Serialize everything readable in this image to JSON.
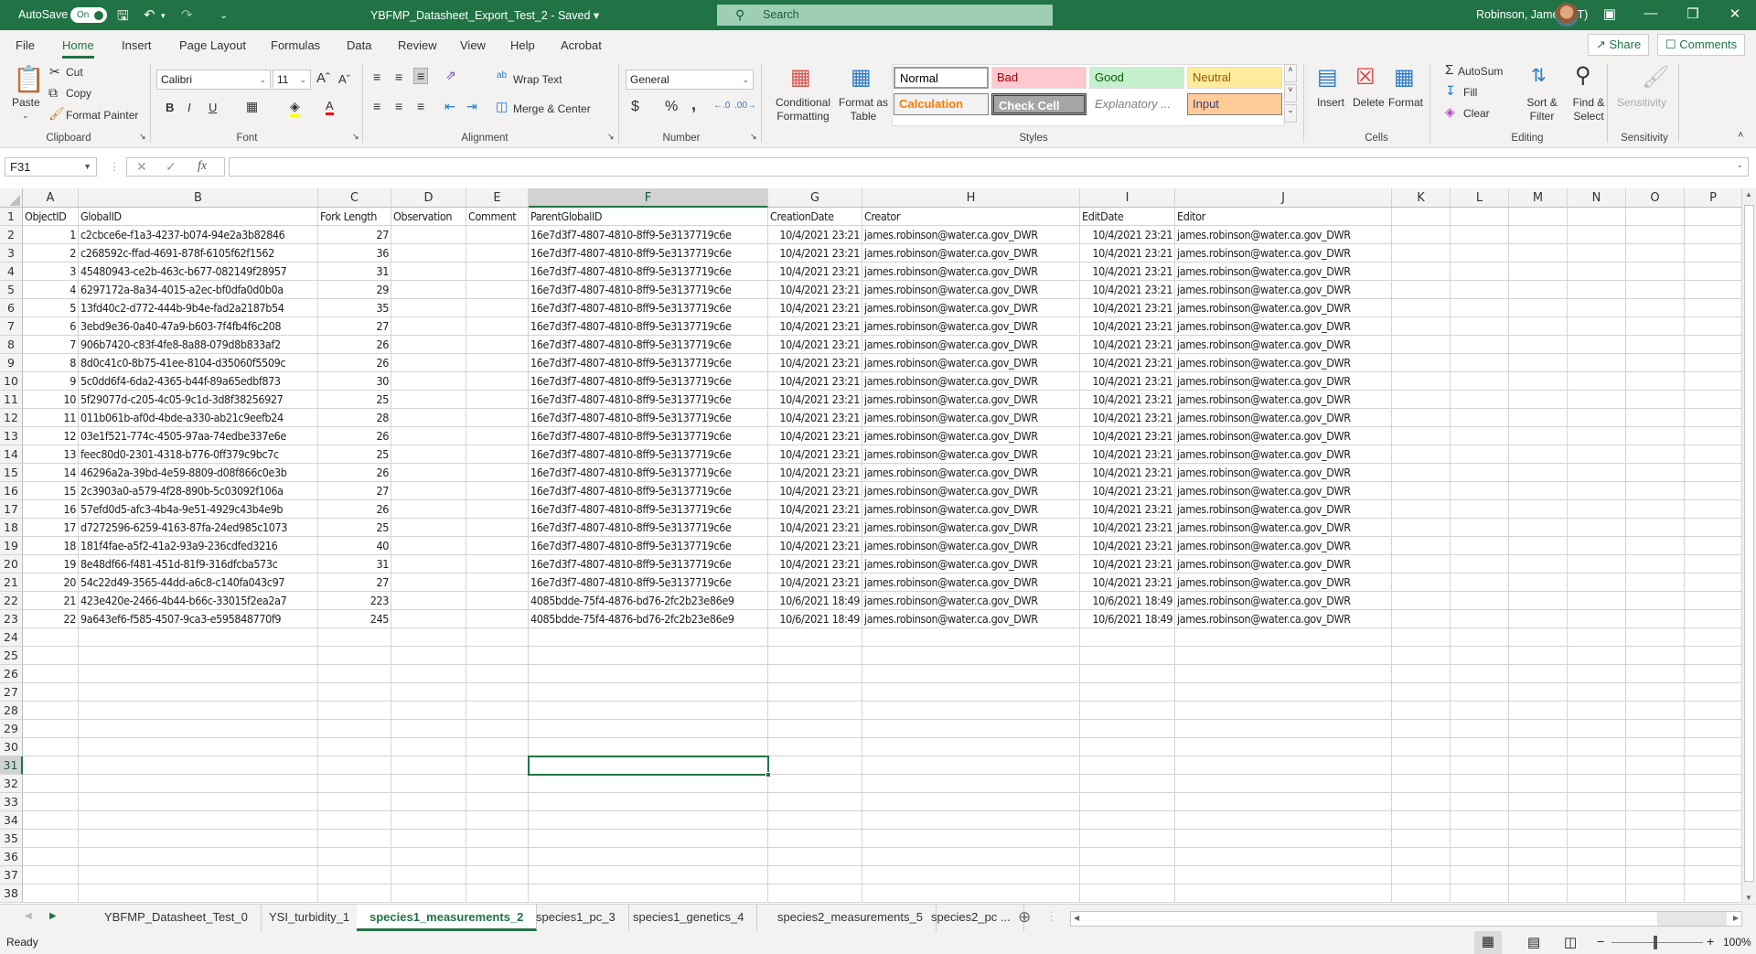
{
  "titlebar": {
    "autosave_label": "AutoSave",
    "autosave_state": "On",
    "document_title": "YBFMP_Datasheet_Export_Test_2 - Saved",
    "search_placeholder": "Search",
    "user_name": "Robinson, James (JT)"
  },
  "menu": {
    "items": [
      "File",
      "Home",
      "Insert",
      "Page Layout",
      "Formulas",
      "Data",
      "Review",
      "View",
      "Help",
      "Acrobat"
    ],
    "active": "Home",
    "share_label": "Share",
    "comments_label": "Comments"
  },
  "ribbon": {
    "clipboard": {
      "paste": "Paste",
      "cut": "Cut",
      "copy": "Copy",
      "format_painter": "Format Painter",
      "label": "Clipboard"
    },
    "font": {
      "name": "Calibri",
      "size": "11",
      "bold": "B",
      "italic": "I",
      "underline": "U",
      "label": "Font"
    },
    "alignment": {
      "wrap_text": "Wrap Text",
      "merge_center": "Merge & Center",
      "label": "Alignment"
    },
    "number": {
      "format": "General",
      "currency": "$",
      "percent": "%",
      "comma": ",",
      "label": "Number"
    },
    "styles": {
      "conditional_formatting": "Conditional Formatting",
      "format_as_table": "Format as Table",
      "cell_styles": [
        {
          "name": "Normal",
          "bg": "#ffffff",
          "fg": "#000000"
        },
        {
          "name": "Bad",
          "bg": "#ffc7ce",
          "fg": "#9c0006"
        },
        {
          "name": "Good",
          "bg": "#c6efce",
          "fg": "#006100"
        },
        {
          "name": "Neutral",
          "bg": "#ffeb9c",
          "fg": "#9c5700"
        },
        {
          "name": "Calculation",
          "bg": "#f2f2f2",
          "fg": "#fa7d00"
        },
        {
          "name": "Check Cell",
          "bg": "#a5a5a5",
          "fg": "#ffffff"
        },
        {
          "name": "Explanatory ...",
          "bg": "#ffffff",
          "fg": "#7f7f7f"
        },
        {
          "name": "Input",
          "bg": "#ffcc99",
          "fg": "#3f3f76"
        }
      ],
      "label": "Styles"
    },
    "cells": {
      "insert": "Insert",
      "delete": "Delete",
      "format": "Format",
      "label": "Cells"
    },
    "editing": {
      "autosum": "AutoSum",
      "fill": "Fill",
      "clear": "Clear",
      "sort_filter": "Sort & Filter",
      "find_select": "Find & Select",
      "label": "Editing"
    },
    "sensitivity": {
      "button": "Sensitivity",
      "label": "Sensitivity"
    }
  },
  "formula_bar": {
    "name_box": "F31",
    "formula": ""
  },
  "sheet": {
    "columns": [
      "A",
      "B",
      "C",
      "D",
      "E",
      "F",
      "G",
      "H",
      "I",
      "J",
      "K",
      "L",
      "M",
      "N",
      "O",
      "P"
    ],
    "selected_column": "F",
    "selected_row": 31,
    "selected_cell": "F31",
    "visible_rows": 38,
    "headers": [
      "ObjectID",
      "GlobalID",
      "Fork Length",
      "Observation",
      "Comment",
      "ParentGlobalID",
      "CreationDate",
      "Creator",
      "EditDate",
      "Editor"
    ],
    "rows": [
      [
        "1",
        "c2cbce6e-f1a3-4237-b074-94e2a3b82846",
        "27",
        "",
        "",
        "16e7d3f7-4807-4810-8ff9-5e3137719c6e",
        "10/4/2021 23:21",
        "james.robinson@water.ca.gov_DWR",
        "10/4/2021 23:21",
        "james.robinson@water.ca.gov_DWR"
      ],
      [
        "2",
        "c268592c-ffad-4691-878f-6105f62f1562",
        "36",
        "",
        "",
        "16e7d3f7-4807-4810-8ff9-5e3137719c6e",
        "10/4/2021 23:21",
        "james.robinson@water.ca.gov_DWR",
        "10/4/2021 23:21",
        "james.robinson@water.ca.gov_DWR"
      ],
      [
        "3",
        "45480943-ce2b-463c-b677-082149f28957",
        "31",
        "",
        "",
        "16e7d3f7-4807-4810-8ff9-5e3137719c6e",
        "10/4/2021 23:21",
        "james.robinson@water.ca.gov_DWR",
        "10/4/2021 23:21",
        "james.robinson@water.ca.gov_DWR"
      ],
      [
        "4",
        "6297172a-8a34-4015-a2ec-bf0dfa0d0b0a",
        "29",
        "",
        "",
        "16e7d3f7-4807-4810-8ff9-5e3137719c6e",
        "10/4/2021 23:21",
        "james.robinson@water.ca.gov_DWR",
        "10/4/2021 23:21",
        "james.robinson@water.ca.gov_DWR"
      ],
      [
        "5",
        "13fd40c2-d772-444b-9b4e-fad2a2187b54",
        "35",
        "",
        "",
        "16e7d3f7-4807-4810-8ff9-5e3137719c6e",
        "10/4/2021 23:21",
        "james.robinson@water.ca.gov_DWR",
        "10/4/2021 23:21",
        "james.robinson@water.ca.gov_DWR"
      ],
      [
        "6",
        "3ebd9e36-0a40-47a9-b603-7f4fb4f6c208",
        "27",
        "",
        "",
        "16e7d3f7-4807-4810-8ff9-5e3137719c6e",
        "10/4/2021 23:21",
        "james.robinson@water.ca.gov_DWR",
        "10/4/2021 23:21",
        "james.robinson@water.ca.gov_DWR"
      ],
      [
        "7",
        "906b7420-c83f-4fe8-8a88-079d8b833af2",
        "26",
        "",
        "",
        "16e7d3f7-4807-4810-8ff9-5e3137719c6e",
        "10/4/2021 23:21",
        "james.robinson@water.ca.gov_DWR",
        "10/4/2021 23:21",
        "james.robinson@water.ca.gov_DWR"
      ],
      [
        "8",
        "8d0c41c0-8b75-41ee-8104-d35060f5509c",
        "26",
        "",
        "",
        "16e7d3f7-4807-4810-8ff9-5e3137719c6e",
        "10/4/2021 23:21",
        "james.robinson@water.ca.gov_DWR",
        "10/4/2021 23:21",
        "james.robinson@water.ca.gov_DWR"
      ],
      [
        "9",
        "5c0dd6f4-6da2-4365-b44f-89a65edbf873",
        "30",
        "",
        "",
        "16e7d3f7-4807-4810-8ff9-5e3137719c6e",
        "10/4/2021 23:21",
        "james.robinson@water.ca.gov_DWR",
        "10/4/2021 23:21",
        "james.robinson@water.ca.gov_DWR"
      ],
      [
        "10",
        "5f29077d-c205-4c05-9c1d-3d8f38256927",
        "25",
        "",
        "",
        "16e7d3f7-4807-4810-8ff9-5e3137719c6e",
        "10/4/2021 23:21",
        "james.robinson@water.ca.gov_DWR",
        "10/4/2021 23:21",
        "james.robinson@water.ca.gov_DWR"
      ],
      [
        "11",
        "011b061b-af0d-4bde-a330-ab21c9eefb24",
        "28",
        "",
        "",
        "16e7d3f7-4807-4810-8ff9-5e3137719c6e",
        "10/4/2021 23:21",
        "james.robinson@water.ca.gov_DWR",
        "10/4/2021 23:21",
        "james.robinson@water.ca.gov_DWR"
      ],
      [
        "12",
        "03e1f521-774c-4505-97aa-74edbe337e6e",
        "26",
        "",
        "",
        "16e7d3f7-4807-4810-8ff9-5e3137719c6e",
        "10/4/2021 23:21",
        "james.robinson@water.ca.gov_DWR",
        "10/4/2021 23:21",
        "james.robinson@water.ca.gov_DWR"
      ],
      [
        "13",
        "feec80d0-2301-4318-b776-0ff379c9bc7c",
        "25",
        "",
        "",
        "16e7d3f7-4807-4810-8ff9-5e3137719c6e",
        "10/4/2021 23:21",
        "james.robinson@water.ca.gov_DWR",
        "10/4/2021 23:21",
        "james.robinson@water.ca.gov_DWR"
      ],
      [
        "14",
        "46296a2a-39bd-4e59-8809-d08f866c0e3b",
        "26",
        "",
        "",
        "16e7d3f7-4807-4810-8ff9-5e3137719c6e",
        "10/4/2021 23:21",
        "james.robinson@water.ca.gov_DWR",
        "10/4/2021 23:21",
        "james.robinson@water.ca.gov_DWR"
      ],
      [
        "15",
        "2c3903a0-a579-4f28-890b-5c03092f106a",
        "27",
        "",
        "",
        "16e7d3f7-4807-4810-8ff9-5e3137719c6e",
        "10/4/2021 23:21",
        "james.robinson@water.ca.gov_DWR",
        "10/4/2021 23:21",
        "james.robinson@water.ca.gov_DWR"
      ],
      [
        "16",
        "57efd0d5-afc3-4b4a-9e51-4929c43b4e9b",
        "26",
        "",
        "",
        "16e7d3f7-4807-4810-8ff9-5e3137719c6e",
        "10/4/2021 23:21",
        "james.robinson@water.ca.gov_DWR",
        "10/4/2021 23:21",
        "james.robinson@water.ca.gov_DWR"
      ],
      [
        "17",
        "d7272596-6259-4163-87fa-24ed985c1073",
        "25",
        "",
        "",
        "16e7d3f7-4807-4810-8ff9-5e3137719c6e",
        "10/4/2021 23:21",
        "james.robinson@water.ca.gov_DWR",
        "10/4/2021 23:21",
        "james.robinson@water.ca.gov_DWR"
      ],
      [
        "18",
        "181f4fae-a5f2-41a2-93a9-236cdfed3216",
        "40",
        "",
        "",
        "16e7d3f7-4807-4810-8ff9-5e3137719c6e",
        "10/4/2021 23:21",
        "james.robinson@water.ca.gov_DWR",
        "10/4/2021 23:21",
        "james.robinson@water.ca.gov_DWR"
      ],
      [
        "19",
        "8e48df66-f481-451d-81f9-316dfcba573c",
        "31",
        "",
        "",
        "16e7d3f7-4807-4810-8ff9-5e3137719c6e",
        "10/4/2021 23:21",
        "james.robinson@water.ca.gov_DWR",
        "10/4/2021 23:21",
        "james.robinson@water.ca.gov_DWR"
      ],
      [
        "20",
        "54c22d49-3565-44dd-a6c8-c140fa043c97",
        "27",
        "",
        "",
        "16e7d3f7-4807-4810-8ff9-5e3137719c6e",
        "10/4/2021 23:21",
        "james.robinson@water.ca.gov_DWR",
        "10/4/2021 23:21",
        "james.robinson@water.ca.gov_DWR"
      ],
      [
        "21",
        "423e420e-2466-4b44-b66c-33015f2ea2a7",
        "223",
        "",
        "",
        "4085bdde-75f4-4876-bd76-2fc2b23e86e9",
        "10/6/2021 18:49",
        "james.robinson@water.ca.gov_DWR",
        "10/6/2021 18:49",
        "james.robinson@water.ca.gov_DWR"
      ],
      [
        "22",
        "9a643ef6-f585-4507-9ca3-e595848770f9",
        "245",
        "",
        "",
        "4085bdde-75f4-4876-bd76-2fc2b23e86e9",
        "10/6/2021 18:49",
        "james.robinson@water.ca.gov_DWR",
        "10/6/2021 18:49",
        "james.robinson@water.ca.gov_DWR"
      ]
    ]
  },
  "sheet_tabs": {
    "tabs": [
      "YBFMP_Datasheet_Test_0",
      "YSI_turbidity_1",
      "species1_measurements_2",
      "species1_pc_3",
      "species1_genetics_4",
      "species2_measurements_5",
      "species2_pc ..."
    ],
    "active_index": 2
  },
  "status": {
    "ready": "Ready",
    "zoom": "100%"
  },
  "colors": {
    "accent": "#217346"
  }
}
